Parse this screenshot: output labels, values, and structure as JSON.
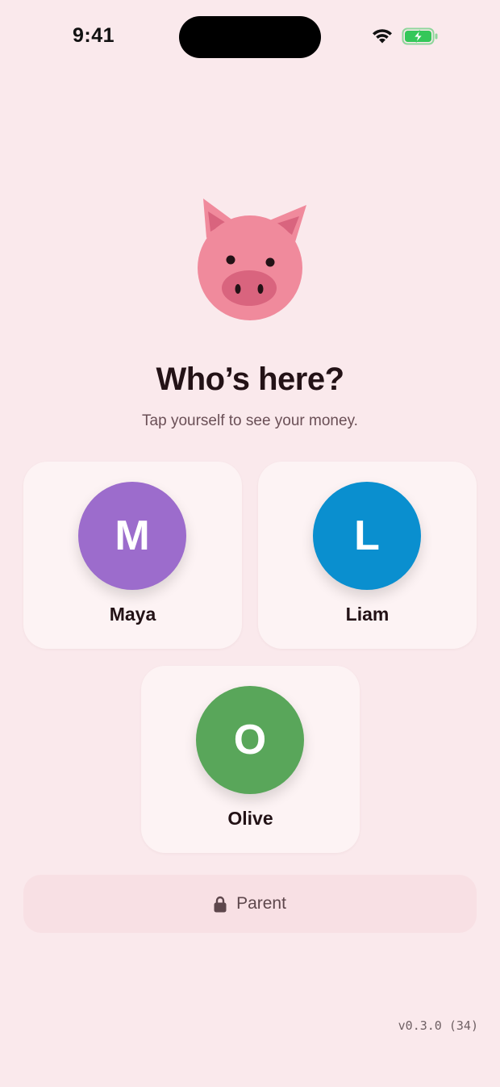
{
  "status_bar": {
    "time": "9:41",
    "icons": [
      "wifi-icon",
      "battery-charging-icon"
    ],
    "battery_color": "#34c759"
  },
  "mascot": {
    "icon": "pig-face-icon",
    "color": "#f08a9c"
  },
  "header": {
    "title": "Who’s here?",
    "subtitle": "Tap yourself to see your money."
  },
  "profiles": [
    {
      "initial": "M",
      "name": "Maya",
      "color": "#9c6ccc"
    },
    {
      "initial": "L",
      "name": "Liam",
      "color": "#0a8fcf"
    },
    {
      "initial": "O",
      "name": "Olive",
      "color": "#59a65a"
    }
  ],
  "parent_button": {
    "label": "Parent",
    "icon": "lock-icon"
  },
  "version": "v0.3.0 (34)"
}
